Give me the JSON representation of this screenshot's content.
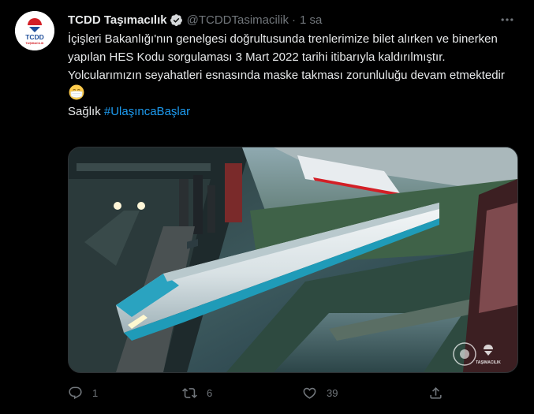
{
  "account": {
    "name": "TCDD Taşımacılık",
    "handle": "@TCDDTasimacilik",
    "separator": "·",
    "time": "1 sa",
    "avatar_label": "TCDD",
    "avatar_sublabel": "TAŞIMACILIK"
  },
  "tweet": {
    "line1": "İçişleri Bakanlığı'nın genelgesi doğrultusunda trenlerimize bilet alırken ve binerken yapılan HES Kodu sorgulaması 3 Mart 2022 tarihi itibarıyla kaldırılmıştır.",
    "line2": "Yolcularımızın seyahatleri esnasında maske takması zorunluluğu devam etmektedir",
    "line3_prefix": "Sağlık ",
    "hashtag": "#UlaşıncaBaşlar"
  },
  "media": {
    "watermark_label": "TAŞIMACILIK"
  },
  "actions": {
    "reply_count": "1",
    "retweet_count": "6",
    "like_count": "39"
  },
  "colors": {
    "background": "#000000",
    "text": "#e7e9ea",
    "muted": "#71767b",
    "link": "#1d9bf0",
    "brand_red": "#d31f26",
    "brand_blue": "#1f4e9a"
  },
  "icons": [
    "verified-badge-icon",
    "more-options-icon",
    "reply-icon",
    "retweet-icon",
    "like-icon",
    "share-icon",
    "face-mask-emoji-icon"
  ]
}
